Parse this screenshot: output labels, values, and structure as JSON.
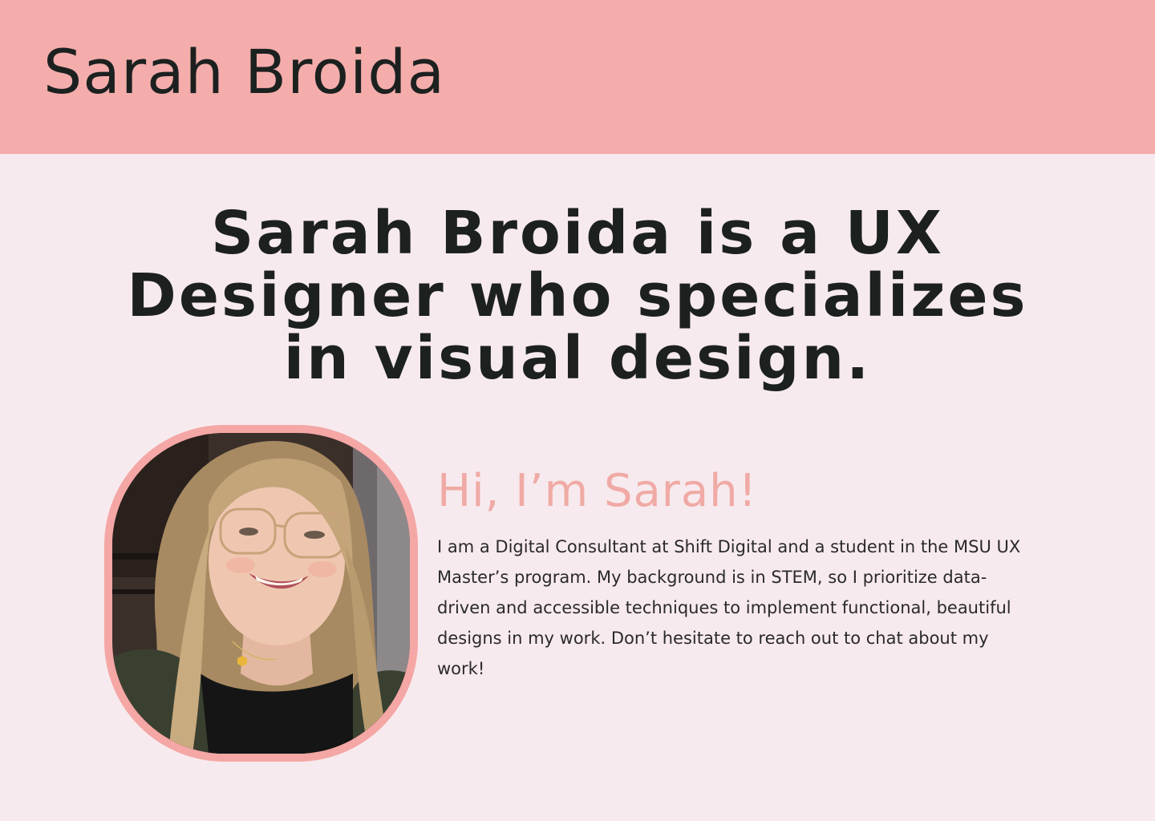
{
  "header": {
    "site_name": "Sarah Broida"
  },
  "hero": {
    "headline": "Sarah Broida is a UX Designer who specializes in visual design."
  },
  "about": {
    "heading": "Hi, I’m Sarah!",
    "body": "I am a Digital Consultant at Shift Digital and a student in the MSU UX Master’s program. My background is in STEM, so I prioritize data-driven and accessible techniques to implement functional, beautiful designs in my work. Don’t hesitate to reach out to chat about my work!"
  },
  "colors": {
    "header_background": "#f4adab",
    "page_background": "#f7eaee",
    "accent_pink": "#f0aaa5",
    "text_dark": "#1c2120"
  }
}
